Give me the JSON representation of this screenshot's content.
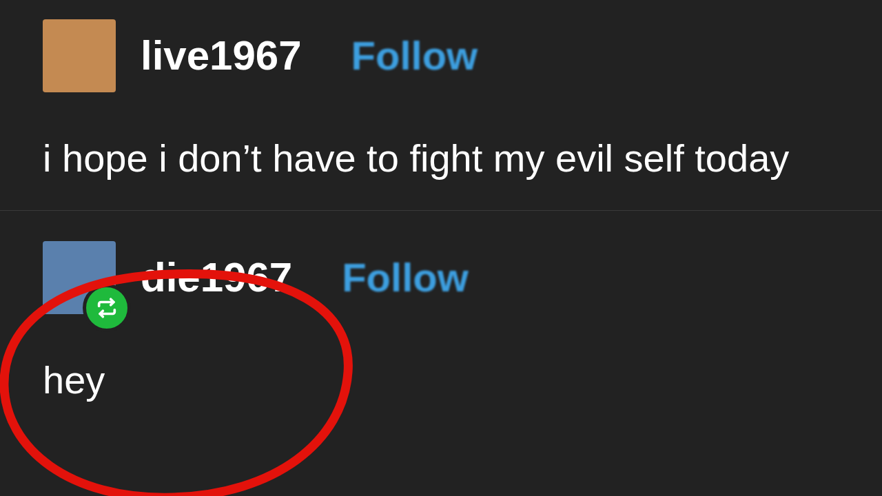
{
  "posts": [
    {
      "username": "live1967",
      "follow": "Follow",
      "text": "i hope i don’t have to fight my evil self today",
      "reblogged": false
    },
    {
      "username": "die1967",
      "follow": "Follow",
      "text": "hey",
      "reblogged": true
    }
  ]
}
